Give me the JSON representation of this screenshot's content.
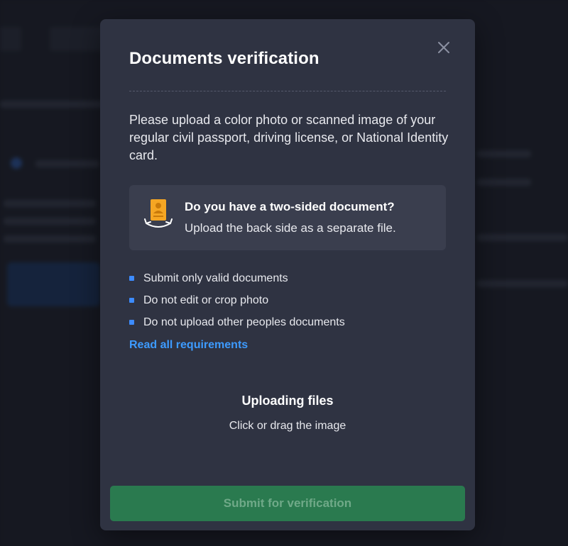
{
  "modal": {
    "title": "Documents verification",
    "intro": "Please upload a color photo or scanned image of your regular civil passport, driving license, or National Identity card.",
    "two_sided": {
      "title": "Do you have a two-sided document?",
      "subtitle": "Upload the back side as a separate file."
    },
    "rules": [
      "Submit only valid documents",
      "Do not edit or crop photo",
      "Do not upload other peoples documents"
    ],
    "requirements_link": "Read all requirements",
    "upload": {
      "title": "Uploading files",
      "subtitle": "Click or drag the image"
    },
    "submit_label": "Submit for verification"
  },
  "colors": {
    "modal_bg": "#2f3342",
    "accent_blue": "#3d8bff",
    "submit_green": "#2a7a4f",
    "icon_orange": "#f5a623"
  },
  "icons": {
    "close": "close-icon",
    "document": "id-document-icon"
  }
}
